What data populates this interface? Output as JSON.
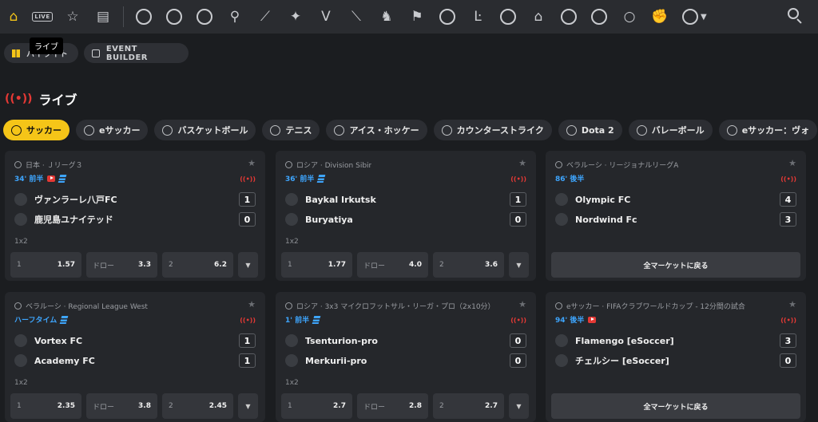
{
  "nav": {
    "icons": [
      "home-icon",
      "live-icon",
      "favorites-star-icon",
      "betslip-icon",
      "soccer-icon",
      "esoccer-icon",
      "basketball-icon",
      "tennis-icon",
      "ice-hockey-icon",
      "counter-strike-icon",
      "valorant-icon",
      "dota2-icon",
      "chess-icon",
      "racing-flag-icon",
      "volleyball-icon",
      "league-of-legends-icon",
      "volta-icon",
      "table-soccer-icon",
      "penalty-icon",
      "handball-icon",
      "cricket-icon",
      "boxing-icon",
      "more-sports-icon"
    ],
    "live_badge": "LIVE",
    "tooltip": "ライブ"
  },
  "top_pills": {
    "highlights": "ハイライト",
    "event_builder": "EVENT BUILDER"
  },
  "section": {
    "title": "ライブ"
  },
  "sport_chips": [
    "サッカー",
    "eサッカー",
    "バスケットボール",
    "テニス",
    "アイス・ホッケー",
    "カウンターストライク",
    "Dota 2",
    "バレーボール",
    "eサッカー：ヴォ"
  ],
  "cards": [
    {
      "league": "日本 · Ｊリーグ３",
      "time": "34' 前半",
      "tv": true,
      "stats": true,
      "teams": [
        {
          "name": "ヴァンラーレ八戸FC",
          "score": "1"
        },
        {
          "name": "鹿児島ユナイテッド",
          "score": "0"
        }
      ],
      "market": "1x2",
      "odds": [
        {
          "label": "1",
          "value": "1.57"
        },
        {
          "label": "ドロー",
          "value": "3.3"
        },
        {
          "label": "2",
          "value": "6.2"
        }
      ]
    },
    {
      "league": "ロシア · Division Sibir",
      "time": "36' 前半",
      "tv": false,
      "stats": true,
      "teams": [
        {
          "name": "Baykal Irkutsk",
          "score": "1"
        },
        {
          "name": "Buryatiya",
          "score": "0"
        }
      ],
      "market": "1x2",
      "odds": [
        {
          "label": "1",
          "value": "1.77"
        },
        {
          "label": "ドロー",
          "value": "4.0"
        },
        {
          "label": "2",
          "value": "3.6"
        }
      ]
    },
    {
      "league": "ベラルーシ · リージョナルリーグA",
      "time": "86' 後半",
      "tv": false,
      "stats": false,
      "teams": [
        {
          "name": "Olympic FC",
          "score": "4"
        },
        {
          "name": "Nordwind Fc",
          "score": "3"
        }
      ],
      "back_label": "全マーケットに戻る"
    },
    {
      "league": "ベラルーシ · Regional League West",
      "time": "ハーフタイム",
      "tv": false,
      "stats": true,
      "teams": [
        {
          "name": "Vortex FC",
          "score": "1"
        },
        {
          "name": "Academy FC",
          "score": "1"
        }
      ],
      "market": "1x2",
      "odds": [
        {
          "label": "1",
          "value": "2.35"
        },
        {
          "label": "ドロー",
          "value": "3.8"
        },
        {
          "label": "2",
          "value": "2.45"
        }
      ]
    },
    {
      "league": "ロシア · 3x3 マイクロフットサル・リーガ・プロ（2x10分）",
      "time": "1' 前半",
      "tv": false,
      "stats": true,
      "teams": [
        {
          "name": "Tsenturion-pro",
          "score": "0"
        },
        {
          "name": "Merkurii-pro",
          "score": "0"
        }
      ],
      "market": "1x2",
      "odds": [
        {
          "label": "1",
          "value": "2.7"
        },
        {
          "label": "ドロー",
          "value": "2.8"
        },
        {
          "label": "2",
          "value": "2.7"
        }
      ]
    },
    {
      "league": "eサッカー · FIFAクラブワールドカップ - 12分間の試合",
      "time": "94' 後半",
      "tv": true,
      "stats": false,
      "teams": [
        {
          "name": "Flamengo [eSoccer]",
          "score": "3"
        },
        {
          "name": "チェルシー [eSoccer]",
          "score": "0"
        }
      ],
      "back_label": "全マーケットに戻る"
    }
  ],
  "colors": {
    "accent": "#f5c518",
    "live": "#e53935",
    "time": "#3ea6ff",
    "card_bg": "#25272b",
    "page_bg": "#1b1d20"
  }
}
